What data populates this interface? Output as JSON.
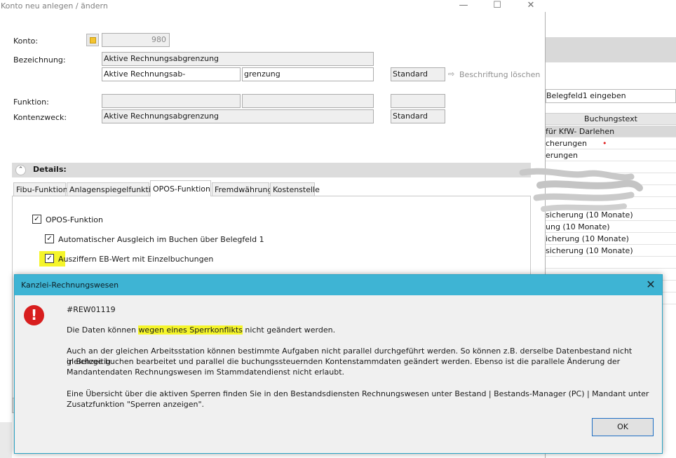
{
  "main_window": {
    "title": "Konto neu anlegen / ändern",
    "labels": {
      "konto": "Konto:",
      "bezeichnung": "Bezeichnung:",
      "funktion": "Funktion:",
      "kontenzweck": "Kontenzweck:"
    },
    "fields": {
      "konto_number": "980",
      "bezeichnung_full": "Aktive Rechnungsabgrenzung",
      "bezeichnung_part1": "Aktive Rechnungsab-",
      "bezeichnung_part2": "grenzung",
      "bezeichnung_style": "Standard",
      "funktion_1": "",
      "funktion_2": "",
      "funktion_3": "",
      "kontenzweck": "Aktive Rechnungsabgrenzung",
      "kontenzweck_style": "Standard"
    },
    "clear_label_button": "Beschriftung löschen",
    "details_title": "Details:",
    "tabs": [
      {
        "label": "Fibu-Funktion",
        "active": false
      },
      {
        "label": "Anlagenspiegelfunktion",
        "active": false
      },
      {
        "label": "OPOS-Funktion",
        "active": true
      },
      {
        "label": "Fremdwährung",
        "active": false
      },
      {
        "label": "Kostenstelle",
        "active": false
      }
    ],
    "checkboxes": [
      {
        "label": "OPOS-Funktion",
        "checked": true
      },
      {
        "label": "Automatischer Ausgleich im Buchen über Belegfeld 1",
        "checked": true
      },
      {
        "label": "Ausziffern EB-Wert mit Einzelbuchungen",
        "checked": true
      }
    ]
  },
  "background_window": {
    "input_text": "Belegfeld1 eingeben",
    "column_header": "Buchungstext",
    "rows": [
      "für KfW- Darlehen",
      "cherungen",
      "erungen",
      "",
      "",
      "",
      "",
      "sicherung (10 Monate)",
      "ung (10 Monate)",
      "icherung  (10 Monate)",
      "sicherung  (10 Monate)",
      "",
      "",
      "",
      ""
    ]
  },
  "error_dialog": {
    "title": "Kanzlei-Rechnungswesen",
    "code": "#REW01119",
    "message_before": "Die Daten können ",
    "message_highlight": "wegen eines Sperrkonflikts",
    "message_after": " nicht geändert werden.",
    "paragraph_1_line_1": "Auch an der gleichen Arbeitsstation können bestimmte Aufgaben nicht parallel durchgeführt werden. So können z.B. derselbe Datenbestand nicht gleichzeitig",
    "paragraph_1_line_2": "in Belege buchen bearbeitet und parallel die buchungssteuernden Kontenstammdaten geändert werden. Ebenso ist die parallele Änderung der",
    "paragraph_1_line_3": "Mandantendaten Rechnungswesen im Stammdatendienst nicht erlaubt.",
    "paragraph_2_line_1": "Eine Übersicht über die aktiven Sperren finden Sie in den Bestandsdiensten Rechnungswesen unter Bestand | Bestands-Manager (PC) | Mandant  unter",
    "paragraph_2_line_2": "Zusatzfunktion \"Sperren anzeigen\".",
    "ok_label": "OK"
  },
  "colors": {
    "dialog_titlebar": "#3eb4d4",
    "highlight": "#f5f52a",
    "error_icon": "#d81e1e"
  },
  "icons": {
    "window_minimize": "minimize-icon",
    "window_maximize": "maximize-icon",
    "window_close": "close-icon",
    "details_toggle": "chevron-up-icon",
    "clear_label": "arrow-right-icon",
    "konto_lookup": "note-icon",
    "error": "error-icon"
  }
}
